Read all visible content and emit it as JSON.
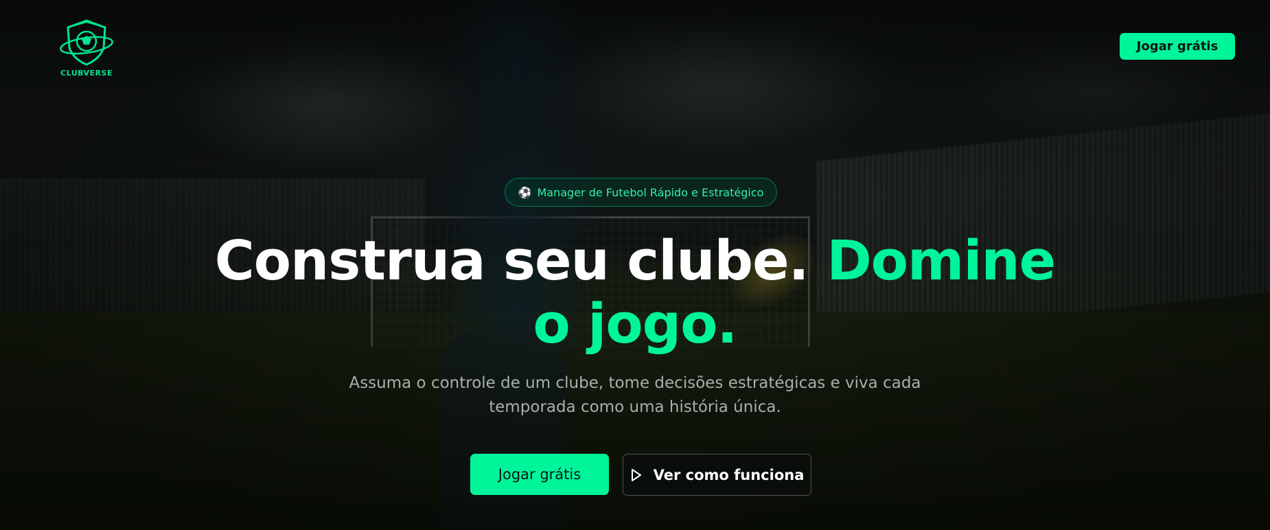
{
  "brand": {
    "name": "CLUBVERSE",
    "accent_color": "#00f59b"
  },
  "header": {
    "cta_label": "Jogar grátis"
  },
  "hero": {
    "badge": {
      "icon": "soccer-ball-icon",
      "icon_glyph": "⚽",
      "text": "Manager de Futebol Rápido e Estratégico"
    },
    "headline_white": "Construa seu clube.",
    "headline_accent_1": "Domine",
    "headline_accent_2": "o jogo.",
    "subtitle_line1": "Assuma o controle de um clube, tome decisões estratégicas e viva cada",
    "subtitle_line2": "temporada como uma história única.",
    "primary_button": "Jogar grátis",
    "secondary_button": "Ver como funciona",
    "secondary_icon": "play-icon"
  }
}
